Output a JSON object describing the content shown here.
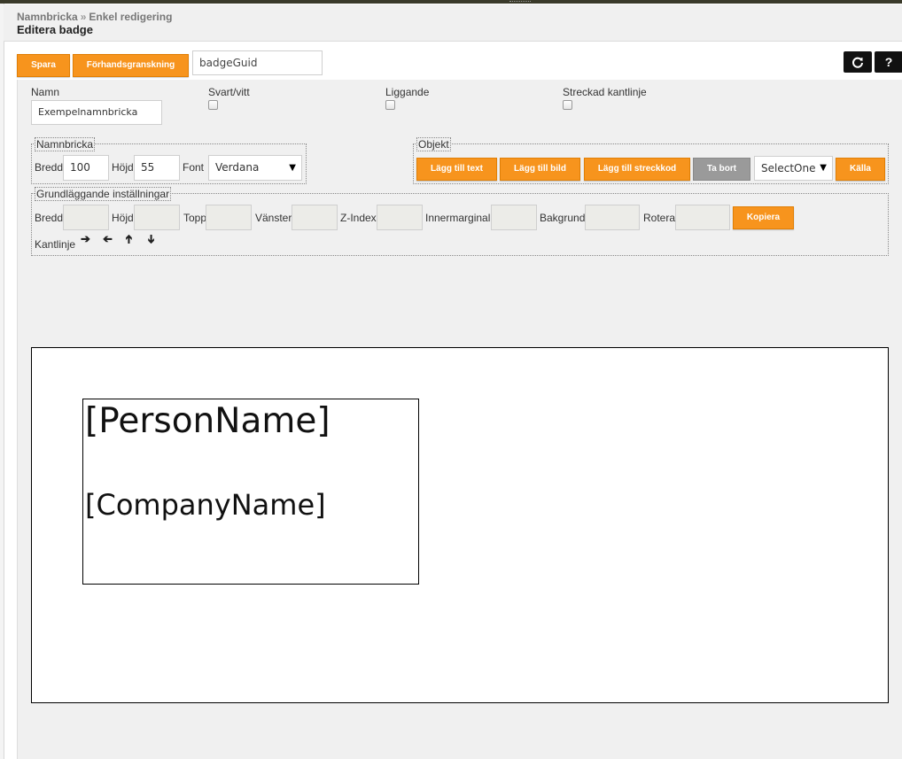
{
  "breadcrumb": {
    "parent": "Namnbricka",
    "separator": "»",
    "current": "Enkel redigering"
  },
  "page_title": "Editera badge",
  "toolbar": {
    "save_label": "Spara",
    "preview_label": "Förhandsgranskning",
    "guid_value": "badgeGuid",
    "refresh_icon": "refresh-icon",
    "help_label": "?"
  },
  "options": {
    "name_label": "Namn",
    "name_value": "Exempelnamnbricka",
    "bw_label": "Svart/vitt",
    "landscape_label": "Liggande",
    "dashed_border_label": "Streckad kantlinje"
  },
  "badge_settings": {
    "legend": "Namnbricka",
    "width_label": "Bredd",
    "width_value": "100",
    "height_label": "Höjd",
    "height_value": "55",
    "font_label": "Font",
    "font_value": "Verdana"
  },
  "objects": {
    "legend": "Objekt",
    "add_text": "Lägg till text",
    "add_image": "Lägg till bild",
    "add_barcode": "Lägg till streckkod",
    "remove": "Ta bort",
    "select_value": "SelectOne",
    "source": "Källa"
  },
  "basic": {
    "legend": "Grundläggande inställningar",
    "width_label": "Bredd",
    "height_label": "Höjd",
    "top_label": "Topp",
    "left_label": "Vänster",
    "zindex_label": "Z-Index",
    "padding_label": "Innermarginal",
    "background_label": "Bakgrund",
    "rotate_label": "Rotera",
    "copy_label": "Kopiera",
    "border_label": "Kantlinje",
    "arrows": [
      "arrow-right-icon",
      "arrow-left-icon",
      "arrow-up-icon",
      "arrow-down-icon"
    ]
  },
  "preview": {
    "person_field": "[PersonName]",
    "company_field": "[CompanyName]"
  },
  "colors": {
    "accent": "#f7941d",
    "remove": "#9a9a9a",
    "panel": "#f0f0f0"
  }
}
